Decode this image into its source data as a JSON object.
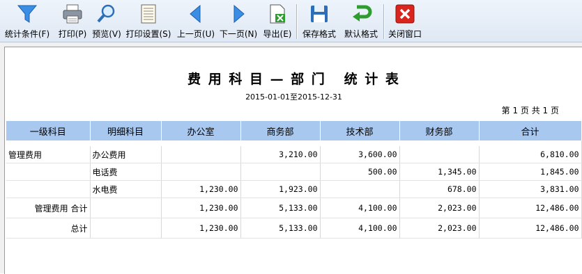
{
  "toolbar": {
    "items": [
      {
        "label": "统计条件(F)",
        "icon": "filter-icon"
      },
      {
        "label": "打印(P)",
        "icon": "printer-icon"
      },
      {
        "label": "预览(V)",
        "icon": "magnifier-icon"
      },
      {
        "label": "打印设置(S)",
        "icon": "page-setup-icon"
      },
      {
        "label": "上一页(U)",
        "icon": "arrow-left-icon"
      },
      {
        "label": "下一页(N)",
        "icon": "arrow-right-icon"
      },
      {
        "label": "导出(E)",
        "icon": "export-excel-icon"
      },
      {
        "label": "保存格式",
        "icon": "floppy-disk-icon"
      },
      {
        "label": "默认格式",
        "icon": "undo-arrow-icon"
      },
      {
        "label": "关闭窗口",
        "icon": "close-red-icon"
      }
    ],
    "colors": {
      "accent_blue": "#2a7de1",
      "green": "#2e9c2e",
      "red": "#d9251d"
    }
  },
  "report": {
    "title": "费 用 科 目 — 部 门   统 计 表",
    "period": "2015-01-01至2015-12-31",
    "page_info": "第 1 页 共 1 页",
    "columns": [
      "一级科目",
      "明细科目",
      "办公室",
      "商务部",
      "技术部",
      "财务部",
      "合计"
    ],
    "rows": [
      [
        "管理费用",
        "办公费用",
        "",
        "3,210.00",
        "3,600.00",
        "",
        "6,810.00"
      ],
      [
        "",
        "电话费",
        "",
        "",
        "500.00",
        "1,345.00",
        "1,845.00"
      ],
      [
        "",
        "水电费",
        "1,230.00",
        "1,923.00",
        "",
        "678.00",
        "3,831.00"
      ],
      [
        "管理费用 合计",
        "",
        "1,230.00",
        "5,133.00",
        "4,100.00",
        "2,023.00",
        "12,486.00"
      ],
      [
        "总计",
        "",
        "1,230.00",
        "5,133.00",
        "4,100.00",
        "2,023.00",
        "12,486.00"
      ]
    ],
    "header_color": "#a8c8f0"
  }
}
